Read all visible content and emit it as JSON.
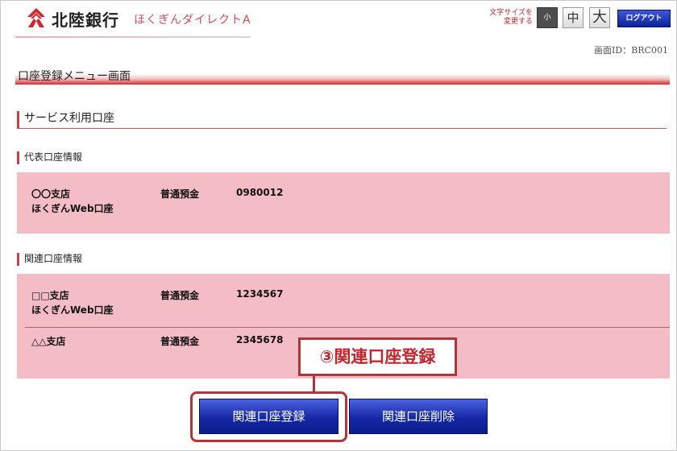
{
  "header": {
    "bank_name": "北陸銀行",
    "service_name": "ほくぎんダイレクトA",
    "font_size_label": "文字サイズを変更する",
    "font_sizes": [
      "小",
      "中",
      "大"
    ],
    "logout_label": "ログアウト",
    "screen_id": "画面ID：BRC001"
  },
  "page": {
    "title": "口座登録メニュー画面"
  },
  "service_accounts": {
    "heading": "サービス利用口座",
    "representative": {
      "heading": "代表口座情報",
      "rows": [
        {
          "branch": "〇〇支店",
          "branch_sub": "ほくぎんWeb口座",
          "type": "普通預金",
          "number": "0980012"
        }
      ]
    },
    "related": {
      "heading": "関連口座情報",
      "rows": [
        {
          "branch": "□□支店",
          "branch_sub": "ほくぎんWeb口座",
          "type": "普通預金",
          "number": "1234567"
        },
        {
          "branch": "△△支店",
          "branch_sub": "",
          "type": "普通預金",
          "number": "2345678"
        }
      ]
    }
  },
  "annotation": {
    "label": "③関連口座登録"
  },
  "actions": {
    "register_label": "関連口座登録",
    "delete_label": "関連口座削除"
  },
  "colors": {
    "brand_red": "#c4262e",
    "panel_pink": "#f4bcc4",
    "button_blue": "#1428a6"
  }
}
